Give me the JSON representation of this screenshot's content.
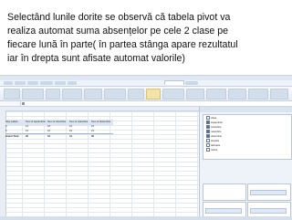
{
  "caption": {
    "lines": [
      "Selectând lunile dorite se observă că tabela pivot va",
      "realiza automat suma absențelor pe cele 2 clase pe",
      "fiecare lună în parte( în partea stânga apare rezultatul",
      "iar în drepta sunt afisate automat valorile)"
    ]
  },
  "pivot": {
    "rows": [
      [
        "Row Labels",
        "Sum of septembrie",
        "Sum of octombrie",
        "Sum of noiembrie",
        "Sum of decembrie"
      ],
      [
        "5",
        "12",
        "18",
        "22",
        "15"
      ],
      [
        "6",
        "14",
        "16",
        "19",
        "21"
      ],
      [
        "Grand Total",
        "26",
        "34",
        "41",
        "36"
      ]
    ]
  },
  "panel": {
    "fields": [
      "clasa",
      "septembrie",
      "octombrie",
      "noiembrie",
      "decembrie",
      "ianuarie",
      "februarie",
      "martie"
    ],
    "checked": [
      false,
      true,
      true,
      true,
      true,
      false,
      false,
      false
    ]
  },
  "colors": {
    "accent": "#3c6fb1",
    "ribbon": "#dfe7f2",
    "panel": "#eef3f9",
    "text": "#111111"
  }
}
